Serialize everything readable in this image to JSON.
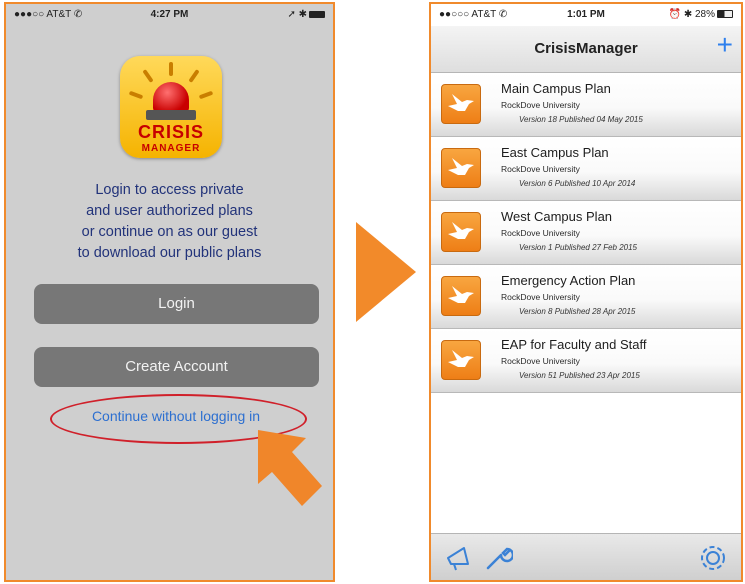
{
  "left_phone": {
    "status_bar": {
      "carrier": "●●●○○ AT&T ✆",
      "time": "4:27 PM",
      "right": "➚ ✱"
    },
    "app_icon": {
      "line1": "CRISIS",
      "line2": "MANAGER"
    },
    "login_message": [
      "Login to access private",
      "and user authorized plans",
      "or continue on as our guest",
      "to download our public plans"
    ],
    "login_button": "Login",
    "create_account_button": "Create Account",
    "continue_link": "Continue without logging in"
  },
  "right_phone": {
    "status_bar": {
      "carrier": "●●○○○ AT&T ✆",
      "time": "1:01 PM",
      "right": "⏰ ✱ 28%"
    },
    "nav": {
      "title": "CrisisManager",
      "add_label": "+"
    },
    "plans": [
      {
        "title": "Main Campus Plan",
        "org": "RockDove University",
        "meta": "Version 18 Published 04 May 2015"
      },
      {
        "title": "East Campus Plan",
        "org": "RockDove University",
        "meta": "Version 6 Published 10 Apr 2014"
      },
      {
        "title": "West Campus Plan",
        "org": "RockDove University",
        "meta": "Version 1 Published 27 Feb 2015"
      },
      {
        "title": "Emergency Action Plan",
        "org": "RockDove University",
        "meta": "Version 8 Published 28 Apr 2015"
      },
      {
        "title": "EAP for Faculty and Staff",
        "org": "RockDove University",
        "meta": "Version 51 Published 23 Apr 2015"
      }
    ],
    "tab_bar": [
      "megaphone-icon",
      "wrench-icon",
      "gear-icon"
    ]
  },
  "colors": {
    "accent_orange": "#f08a2c",
    "link_blue": "#2c6fd0",
    "highlight_red": "#d0202a",
    "button_gray": "#777777"
  }
}
